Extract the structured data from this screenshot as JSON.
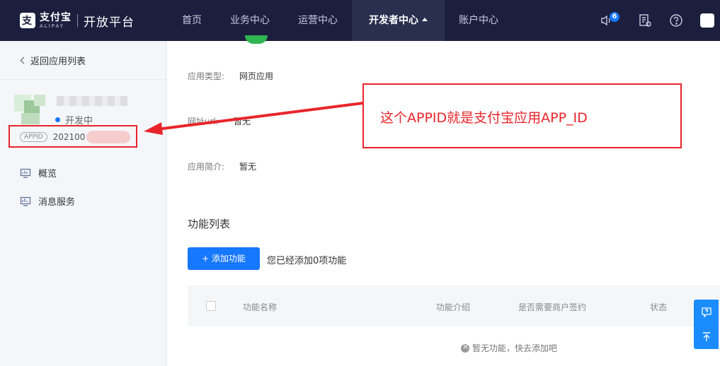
{
  "topbar": {
    "logo_cn": "支付宝",
    "logo_en": "ALIPAY",
    "platform": "开放平台",
    "nav": [
      {
        "label": "首页"
      },
      {
        "label": "业务中心"
      },
      {
        "label": "运营中心"
      },
      {
        "label": "开发者中心",
        "active": true
      },
      {
        "label": "账户中心"
      }
    ],
    "notification_count": "6",
    "icons": [
      "speaker-icon",
      "doc-clock-icon",
      "help-icon",
      "app-icon"
    ]
  },
  "sidebar": {
    "back_label": "返回应用列表",
    "status_label": "开发中",
    "appid_tag": "APPID",
    "appid_value": "202100",
    "items": [
      {
        "label": "概览",
        "icon": "monitor-chart-icon"
      },
      {
        "label": "消息服务",
        "icon": "message-chart-icon"
      }
    ]
  },
  "main": {
    "fields": [
      {
        "label": "应用类型:",
        "value": "网页应用"
      },
      {
        "label": "网址url:",
        "value": "暂无"
      },
      {
        "label": "应用简介:",
        "value": "暂无"
      }
    ],
    "section_title": "功能列表",
    "add_button": "+ 添加功能",
    "add_note": "您已经添加0项功能",
    "table_headers": [
      "功能名称",
      "功能介绍",
      "是否需要商户签约",
      "状态"
    ],
    "empty_text": "暂无功能，快去添加吧"
  },
  "callout": {
    "text": "这个APPID就是支付宝应用APP_ID"
  },
  "colors": {
    "topbar": "#1b1f3d",
    "accent": "#1677ff",
    "annotation": "#e8252b"
  }
}
